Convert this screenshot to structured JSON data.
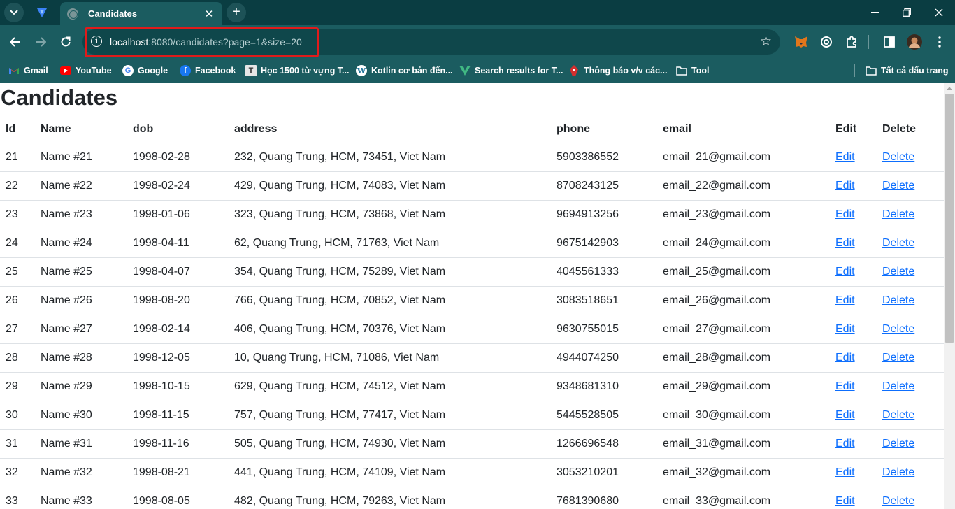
{
  "tab": {
    "title": "Candidates",
    "close": "✕"
  },
  "newtab": "+",
  "window": {
    "minimize": "—",
    "restore": "❐",
    "close": "✕"
  },
  "nav": {
    "back": "←",
    "forward": "→",
    "reload": "↻"
  },
  "address": {
    "host": "localhost",
    "rest": ":8080/candidates?page=1&size=20"
  },
  "bookmarks": [
    {
      "label": "Gmail",
      "icon": "gmail-icon"
    },
    {
      "label": "YouTube",
      "icon": "youtube-icon"
    },
    {
      "label": "Google",
      "icon": "google-icon"
    },
    {
      "label": "Facebook",
      "icon": "facebook-icon"
    },
    {
      "label": "Học 1500 từ vựng T...",
      "icon": "letter-t-icon"
    },
    {
      "label": "Kotlin cơ bản đến...",
      "icon": "wordpress-icon"
    },
    {
      "label": "Search results for T...",
      "icon": "v-logo-icon"
    },
    {
      "label": "Thông báo v/v các...",
      "icon": "red-logo-icon"
    },
    {
      "label": "Tool",
      "icon": "folder-icon"
    },
    {
      "label": "Tất cả dấu trang",
      "icon": "folder-icon"
    }
  ],
  "page": {
    "title": "Candidates",
    "columns": [
      "Id",
      "Name",
      "dob",
      "address",
      "phone",
      "email",
      "Edit",
      "Delete"
    ],
    "edit_label": "Edit",
    "delete_label": "Delete",
    "rows": [
      {
        "id": "21",
        "name": "Name #21",
        "dob": "1998-02-28",
        "address": "232, Quang Trung, HCM, 73451, Viet Nam",
        "phone": "5903386552",
        "email": "email_21@gmail.com"
      },
      {
        "id": "22",
        "name": "Name #22",
        "dob": "1998-02-24",
        "address": "429, Quang Trung, HCM, 74083, Viet Nam",
        "phone": "8708243125",
        "email": "email_22@gmail.com"
      },
      {
        "id": "23",
        "name": "Name #23",
        "dob": "1998-01-06",
        "address": "323, Quang Trung, HCM, 73868, Viet Nam",
        "phone": "9694913256",
        "email": "email_23@gmail.com"
      },
      {
        "id": "24",
        "name": "Name #24",
        "dob": "1998-04-11",
        "address": "62, Quang Trung, HCM, 71763, Viet Nam",
        "phone": "9675142903",
        "email": "email_24@gmail.com"
      },
      {
        "id": "25",
        "name": "Name #25",
        "dob": "1998-04-07",
        "address": "354, Quang Trung, HCM, 75289, Viet Nam",
        "phone": "4045561333",
        "email": "email_25@gmail.com"
      },
      {
        "id": "26",
        "name": "Name #26",
        "dob": "1998-08-20",
        "address": "766, Quang Trung, HCM, 70852, Viet Nam",
        "phone": "3083518651",
        "email": "email_26@gmail.com"
      },
      {
        "id": "27",
        "name": "Name #27",
        "dob": "1998-02-14",
        "address": "406, Quang Trung, HCM, 70376, Viet Nam",
        "phone": "9630755015",
        "email": "email_27@gmail.com"
      },
      {
        "id": "28",
        "name": "Name #28",
        "dob": "1998-12-05",
        "address": "10, Quang Trung, HCM, 71086, Viet Nam",
        "phone": "4944074250",
        "email": "email_28@gmail.com"
      },
      {
        "id": "29",
        "name": "Name #29",
        "dob": "1998-10-15",
        "address": "629, Quang Trung, HCM, 74512, Viet Nam",
        "phone": "9348681310",
        "email": "email_29@gmail.com"
      },
      {
        "id": "30",
        "name": "Name #30",
        "dob": "1998-11-15",
        "address": "757, Quang Trung, HCM, 77417, Viet Nam",
        "phone": "5445528505",
        "email": "email_30@gmail.com"
      },
      {
        "id": "31",
        "name": "Name #31",
        "dob": "1998-11-16",
        "address": "505, Quang Trung, HCM, 74930, Viet Nam",
        "phone": "1266696548",
        "email": "email_31@gmail.com"
      },
      {
        "id": "32",
        "name": "Name #32",
        "dob": "1998-08-21",
        "address": "441, Quang Trung, HCM, 74109, Viet Nam",
        "phone": "3053210201",
        "email": "email_32@gmail.com"
      },
      {
        "id": "33",
        "name": "Name #33",
        "dob": "1998-08-05",
        "address": "482, Quang Trung, HCM, 79263, Viet Nam",
        "phone": "7681390680",
        "email": "email_33@gmail.com"
      }
    ]
  },
  "colors": {
    "chrome_dark": "#0a3d42",
    "chrome": "#1b5c60",
    "link": "#0d6efd",
    "highlight": "#e01b1b"
  }
}
